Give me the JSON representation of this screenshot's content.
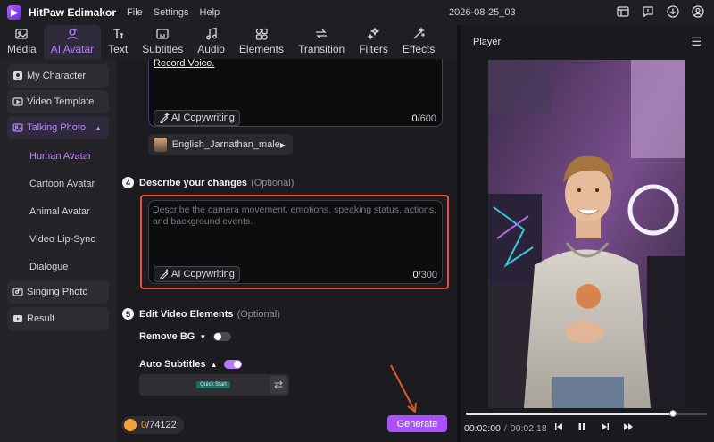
{
  "titlebar": {
    "app_name": "HitPaw Edimakor",
    "menus": [
      "File",
      "Settings",
      "Help"
    ],
    "project_date": "2026-08-25_03",
    "icons": [
      "layout-icon",
      "feedback-icon",
      "download-icon",
      "profile-icon"
    ]
  },
  "toolbar": {
    "tools": [
      {
        "label": "Media",
        "icon": "media-icon"
      },
      {
        "label": "AI Avatar",
        "icon": "avatar-icon",
        "active": true
      },
      {
        "label": "Text",
        "icon": "text-icon"
      },
      {
        "label": "Subtitles",
        "icon": "subtitles-icon"
      },
      {
        "label": "Audio",
        "icon": "audio-icon"
      },
      {
        "label": "Elements",
        "icon": "elements-icon"
      },
      {
        "label": "Transition",
        "icon": "transition-icon"
      },
      {
        "label": "Filters",
        "icon": "filters-icon"
      },
      {
        "label": "Effects",
        "icon": "effects-icon"
      }
    ]
  },
  "sidebar": {
    "items": [
      {
        "label": "My Character"
      },
      {
        "label": "Video Template"
      },
      {
        "label": "Talking Photo",
        "active": true
      }
    ],
    "sub_items": [
      {
        "label": "Human Avatar",
        "active": true
      },
      {
        "label": "Cartoon Avatar"
      },
      {
        "label": "Animal Avatar"
      },
      {
        "label": "Video Lip-Sync"
      },
      {
        "label": "Dialogue"
      }
    ],
    "bottom_items": [
      {
        "label": "Singing Photo"
      },
      {
        "label": "Result"
      }
    ]
  },
  "script_card": {
    "text": "Record Voice.",
    "ai_label": "AI Copywriting",
    "count_current": "0",
    "count_max": "/600"
  },
  "voice": {
    "name": "English_Jarnathan_male"
  },
  "step4": {
    "number": "4",
    "title": "Describe your changes",
    "optional": "(Optional)",
    "placeholder": "Describe the camera movement, emotions, speaking status, actions, and background events.",
    "ai_label": "AI Copywriting",
    "count_current": "0",
    "count_max": "/300"
  },
  "step5": {
    "number": "5",
    "title": "Edit Video Elements",
    "optional": "(Optional)",
    "remove_bg_label": "Remove BG",
    "remove_bg_on": false,
    "auto_subtitles_label": "Auto Subtitles",
    "auto_subtitles_on": true,
    "subtitle_preview": "Quick Start"
  },
  "footer": {
    "credits_used": "0",
    "credits_total": "/74122",
    "generate_label": "Generate"
  },
  "player": {
    "title": "Player",
    "current_time": "00:02:00",
    "separator": "/",
    "total_time": "00:02:18",
    "progress": 0.86
  },
  "colors": {
    "accent": "#a950ff",
    "highlight_border": "#e0552f"
  }
}
